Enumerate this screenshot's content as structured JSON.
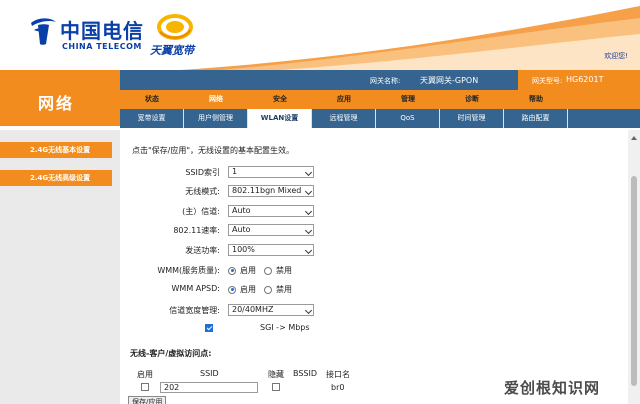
{
  "brand": {
    "telecom_cn": "中国电信",
    "telecom_en": "CHINA TELECOM",
    "tianyi": "天翼宽带",
    "welcome": "欢迎您!"
  },
  "section_title": "网络",
  "info": {
    "gateway_name_label": "网关名称:",
    "gateway_name": "天翼网关-GPON",
    "model_label": "网关型号:",
    "model": "HG6201T"
  },
  "main_nav": [
    "状态",
    "网络",
    "安全",
    "应用",
    "管理",
    "诊断",
    "帮助"
  ],
  "main_nav_active": 1,
  "sub_nav": [
    "宽带设置",
    "用户侧管理",
    "WLAN设置",
    "远程管理",
    "QoS",
    "时间管理",
    "路由配置"
  ],
  "sub_nav_active": 2,
  "sidebar": [
    "2.4G无线基本设置",
    "2.4G无线高级设置"
  ],
  "form": {
    "intro": "点击\"保存/应用\"，无线设置的基本配置生效。",
    "ssid_index_label": "SSID索引",
    "ssid_index": "1",
    "wireless_mode_label": "无线模式:",
    "wireless_mode": "802.11bgn Mixed",
    "channel_label": "(主）信道:",
    "channel": "Auto",
    "rate_label": "802.11速率:",
    "rate": "Auto",
    "power_label": "发送功率:",
    "power": "100%",
    "wmm_label": "WMM(服务质量):",
    "wmm_apsd_label": "WMM APSD:",
    "enable": "启用",
    "disable": "禁用",
    "bandwidth_label": "信道宽度管理:",
    "bandwidth": "20/40MHZ",
    "sgi": "SGI -> Mbps"
  },
  "ap": {
    "heading": "无线-客户/虚拟访问点:",
    "headers": {
      "enable": "启用",
      "ssid": "SSID",
      "hide": "隐藏",
      "bssid": "BSSID",
      "iface": "接口名"
    },
    "row": {
      "ssid": "202",
      "iface": "br0"
    },
    "save_button": "保存/应用"
  },
  "watermark": "爱创根知识网"
}
